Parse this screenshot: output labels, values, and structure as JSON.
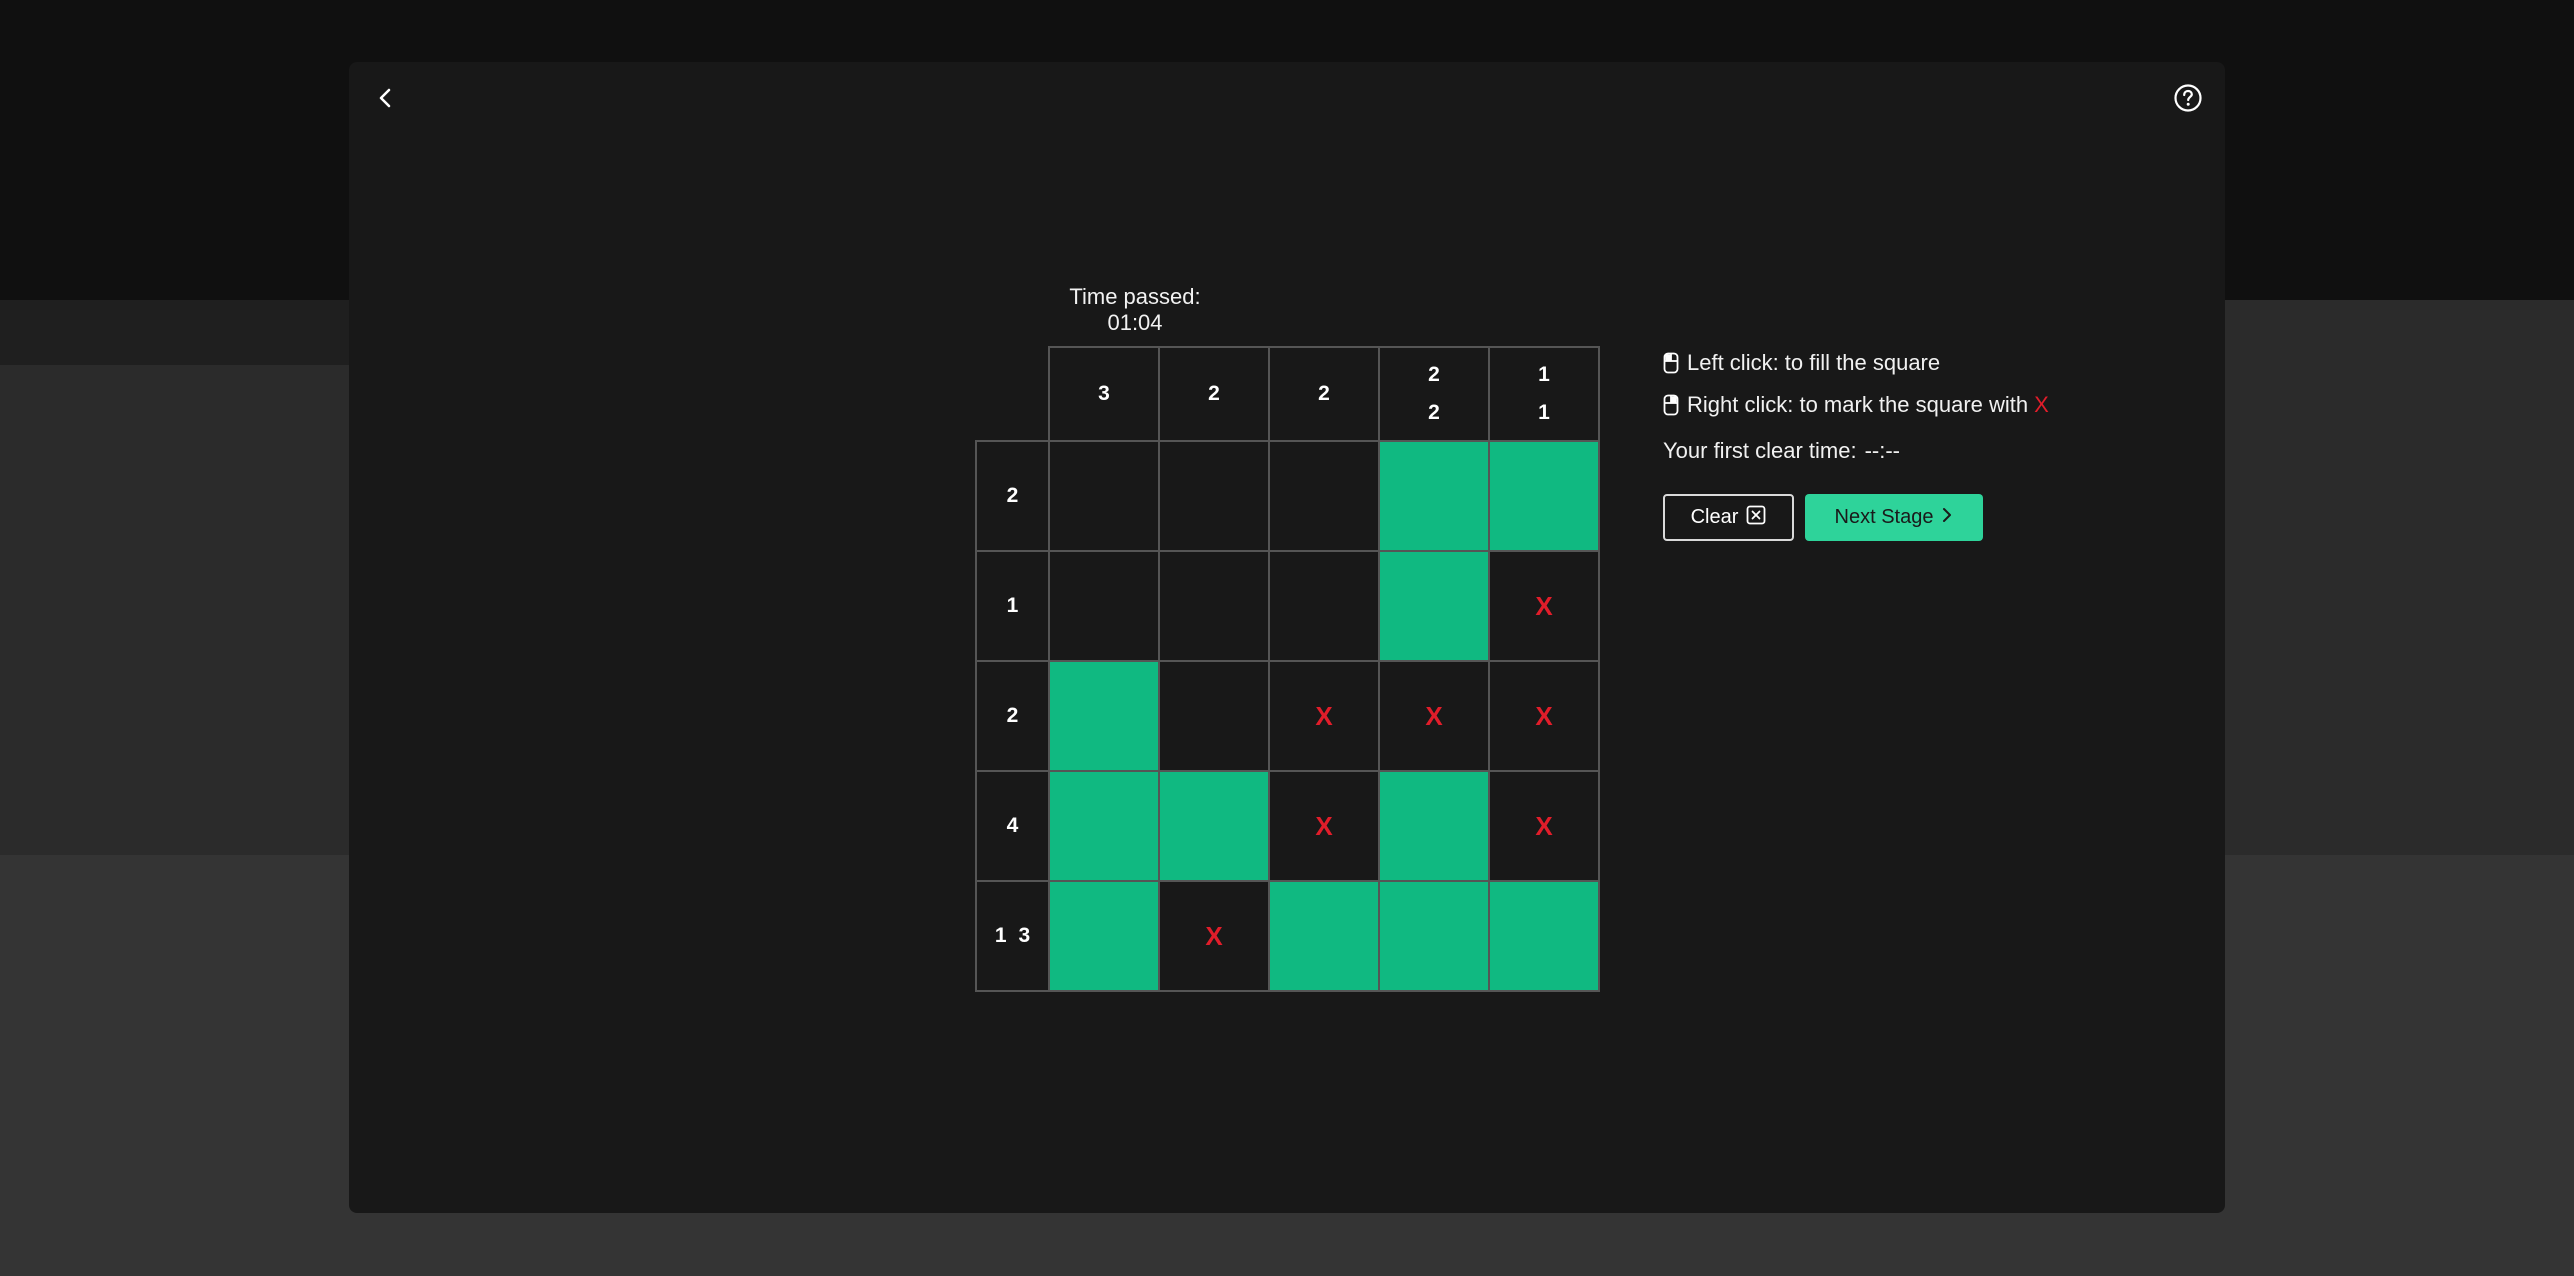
{
  "header": {
    "back_icon": "chevron-left-icon",
    "help_icon": "question-circle-icon"
  },
  "timer": {
    "label": "Time passed: 01:04"
  },
  "board": {
    "column_clues": [
      [
        "3"
      ],
      [
        "2"
      ],
      [
        "2"
      ],
      [
        "2",
        "2"
      ],
      [
        "1",
        "1"
      ]
    ],
    "row_clues": [
      [
        "2"
      ],
      [
        "1"
      ],
      [
        "2"
      ],
      [
        "4"
      ],
      [
        "1",
        "3"
      ]
    ],
    "cells": [
      [
        "empty",
        "empty",
        "empty",
        "filled",
        "filled"
      ],
      [
        "empty",
        "empty",
        "empty",
        "filled",
        "x"
      ],
      [
        "filled",
        "empty",
        "x",
        "x",
        "x"
      ],
      [
        "filled",
        "filled",
        "x",
        "filled",
        "x"
      ],
      [
        "filled",
        "x",
        "filled",
        "filled",
        "filled"
      ]
    ],
    "mark_symbol": "X",
    "fill_color": "#10b981",
    "mark_color": "#e11d2a"
  },
  "instructions": {
    "left_click": "Left click: to fill the square",
    "right_click": "Right click: to mark the square with",
    "right_click_mark": "X",
    "icon": "mouse-icon"
  },
  "best_time": {
    "label": "Your first clear time:",
    "value": "--:--"
  },
  "actions": {
    "clear_label": "Clear",
    "clear_icon": "x-square-icon",
    "next_label": "Next Stage",
    "next_icon": "chevron-right-icon",
    "accent_color": "#2ed39a"
  }
}
